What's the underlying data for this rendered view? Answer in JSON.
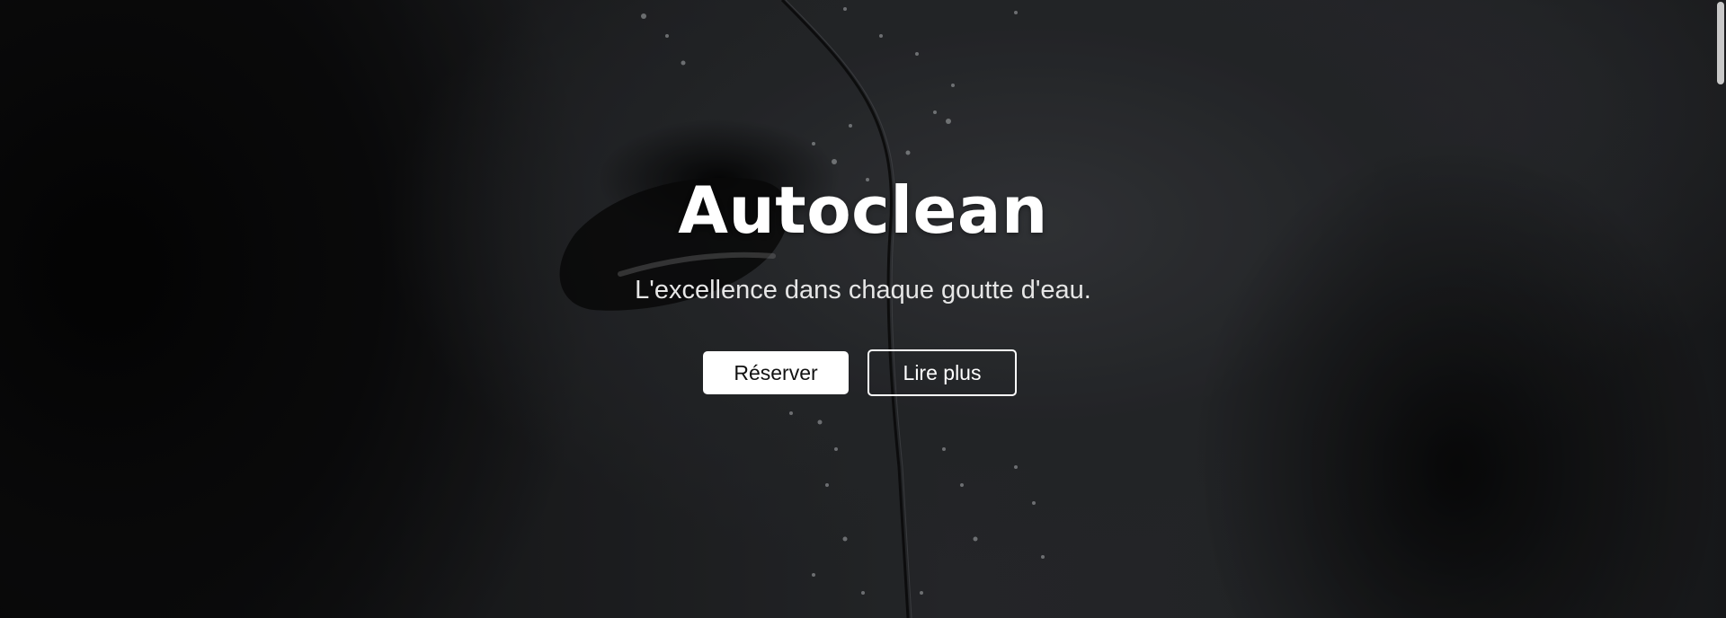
{
  "hero": {
    "title": "Autoclean",
    "tagline": "L'excellence dans chaque goutte d'eau.",
    "background_description_icon": "car-door-rain-photo"
  },
  "actions": {
    "reserve_label": "Réserver",
    "read_more_label": "Lire plus"
  },
  "colors": {
    "text_primary": "#ffffff",
    "button_fill": "#ffffff",
    "button_text_dark": "#111111"
  }
}
